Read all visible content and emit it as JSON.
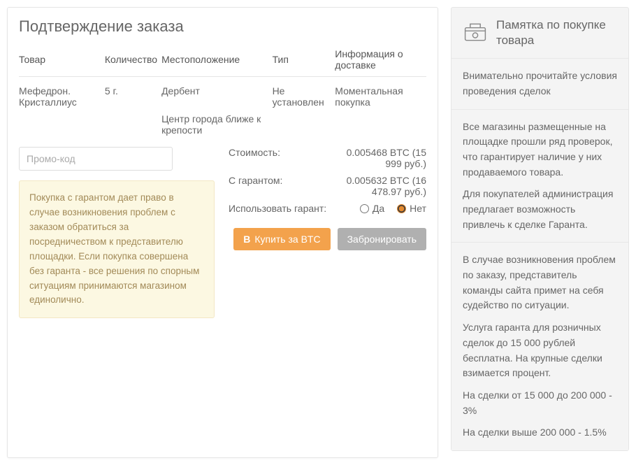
{
  "title": "Подтверждение заказа",
  "headers": {
    "product": "Товар",
    "qty": "Количество",
    "location": "Местоположение",
    "type": "Тип",
    "delivery": "Информация о доставке"
  },
  "row": {
    "product": "Мефедрон. Кристаллиус",
    "qty": "5 г.",
    "location": "Дербент",
    "location_extra": "Центр города ближе к крепости",
    "type": "Не установлен",
    "delivery": "Моментальная покупка"
  },
  "promo_placeholder": "Промо-код",
  "alert_text": "Покупка с гарантом дает право в случае возникновения проблем с заказом обратиться за посредничеством к представителю площадки. Если покупка совершена без гаранта - все решения по спорным ситуациям принимаются магазином единолично.",
  "prices": {
    "cost_label": "Стоимость:",
    "cost_value": "0.005468 BTC (15 999 руб.)",
    "guarantor_label": "С гарантом:",
    "guarantor_value": "0.005632 BTC (16 478.97 руб.)",
    "use_guarantor_label": "Использовать гарант:",
    "yes": "Да",
    "no": "Нет"
  },
  "buttons": {
    "buy": "Купить за BTC",
    "reserve": "Забронировать"
  },
  "sidebar": {
    "title": "Памятка по покупке товара",
    "block1": "Внимательно прочитайте условия проведения сделок",
    "block2_p1": "Все магазины размещенные на площадке прошли ряд проверок, что гарантирует наличие у них продаваемого товара.",
    "block2_p2": "Для покупателей администрация предлагает возможность привлечь к сделке Гаранта.",
    "block3_p1": "В случае возникновения проблем по заказу, представитель команды сайта примет на себя судейство по ситуации.",
    "block3_p2": "Услуга гаранта для розничных сделок до 15 000 рублей бесплатна. На крупные сделки взимается процент.",
    "block3_p3": "На сделки от 15 000 до 200 000 - 3%",
    "block3_p4": "На сделки выше 200 000 - 1.5%"
  }
}
